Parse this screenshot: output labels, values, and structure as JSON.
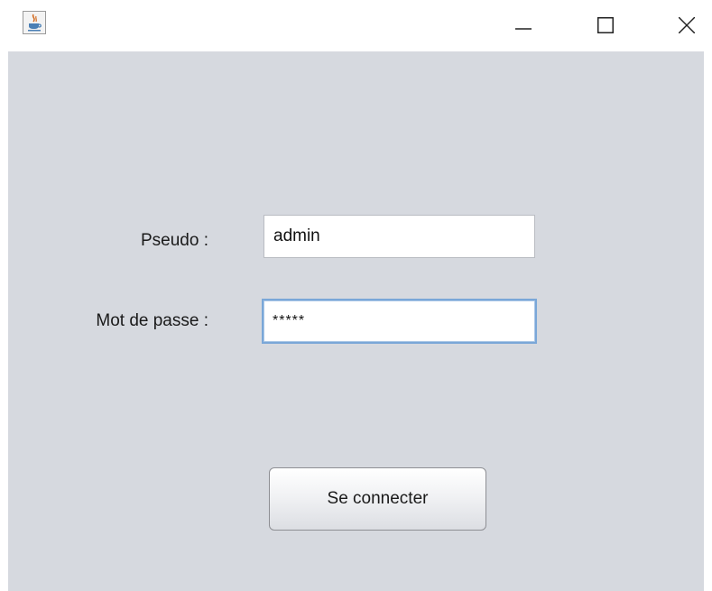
{
  "window": {
    "icon": "java-coffee-icon",
    "controls": {
      "minimize": "minimize-icon",
      "maximize": "maximize-icon",
      "close": "close-icon"
    }
  },
  "form": {
    "pseudo_label": "Pseudo :",
    "pseudo_value": "admin",
    "password_label": "Mot de passe :",
    "password_value": "*****",
    "submit_label": "Se connecter"
  },
  "colors": {
    "panel_background": "#d6d9df",
    "focus_border": "#7aa7d8"
  }
}
